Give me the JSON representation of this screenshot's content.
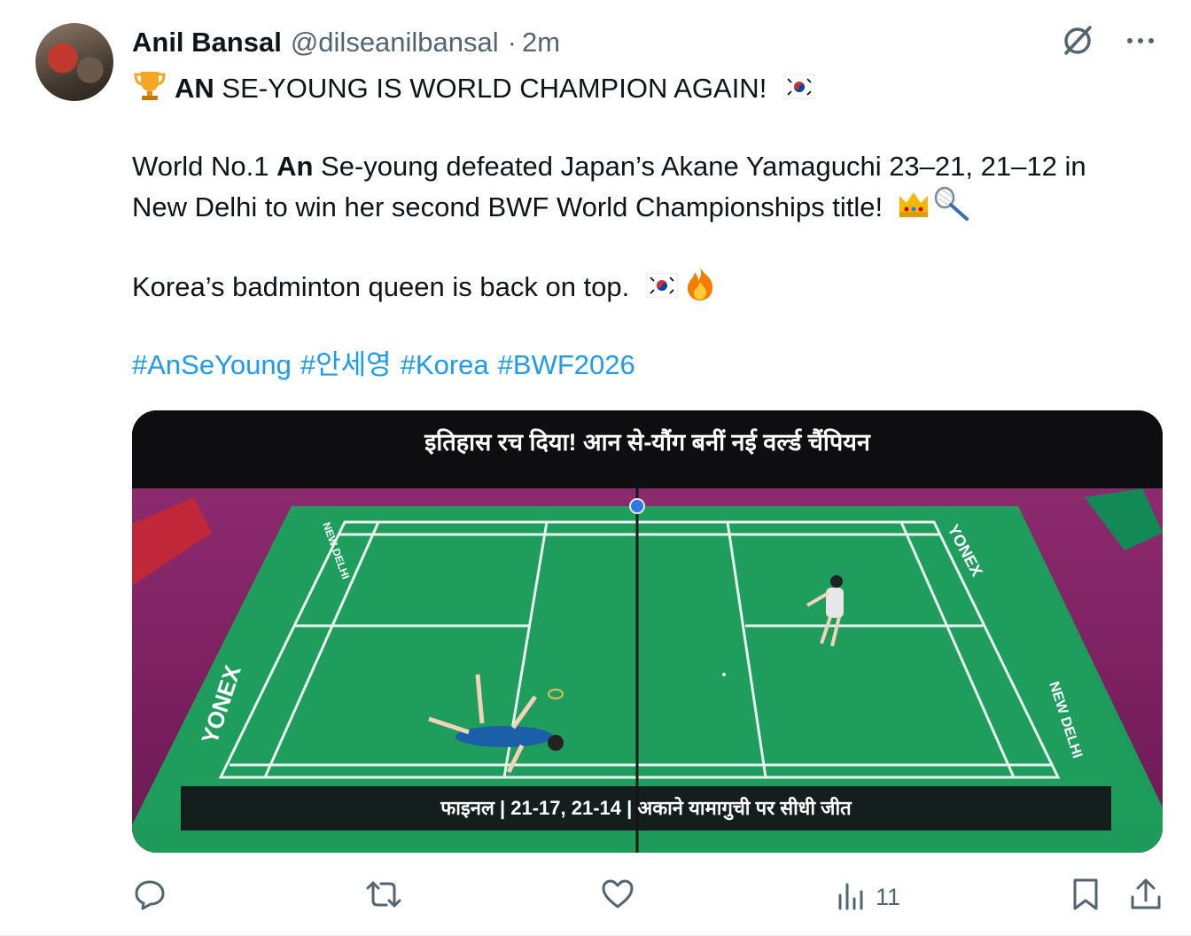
{
  "post": {
    "author_name": "Anil Bansal",
    "author_handle": "@dilseanilbansal",
    "separator": "·",
    "time": "2m",
    "headline_bold": "AN",
    "headline_rest": " SE-YOUNG IS WORLD CHAMPION AGAIN!",
    "para1_start": "World No.1 ",
    "para1_bold": "An",
    "para1_rest": " Se-young defeated Japan’s Akane Yamaguchi 23–21, 21–12 in",
    "para1_line2": "New Delhi to win her second BWF World Championships title!",
    "para2": "Korea’s badminton queen is back on top.",
    "hashtags": [
      "#AnSeYoung",
      "#안세영",
      "#Korea",
      "#BWF2026"
    ]
  },
  "media": {
    "caption_top": "इतिहास रच दिया! आन से-यौंग बनीं नई वर्ल्ड चैंपियन",
    "caption_bottom": "फाइनल  |  21-17, 21-14  |  अकाने यामागुची पर सीधी जीत",
    "court_brand": "YONEX",
    "court_city": "NEW DELHI"
  },
  "actions": {
    "views_count": "11"
  },
  "icons": {
    "header": [
      "grok-icon",
      "more-icon"
    ],
    "headline_emoji": [
      "trophy-icon",
      "korea-flag-icon"
    ],
    "para1_emoji": [
      "crown-icon",
      "badminton-icon"
    ],
    "para2_emoji": [
      "korea-flag-icon",
      "fire-icon"
    ],
    "actions": [
      "reply-icon",
      "repost-icon",
      "like-icon",
      "views-icon",
      "bookmark-icon",
      "share-icon"
    ]
  },
  "colors": {
    "link": "#1d9bf0",
    "secondary_text": "#536471",
    "court_green": "#1e9a5b",
    "arena_magenta": "#7a1f5e"
  }
}
